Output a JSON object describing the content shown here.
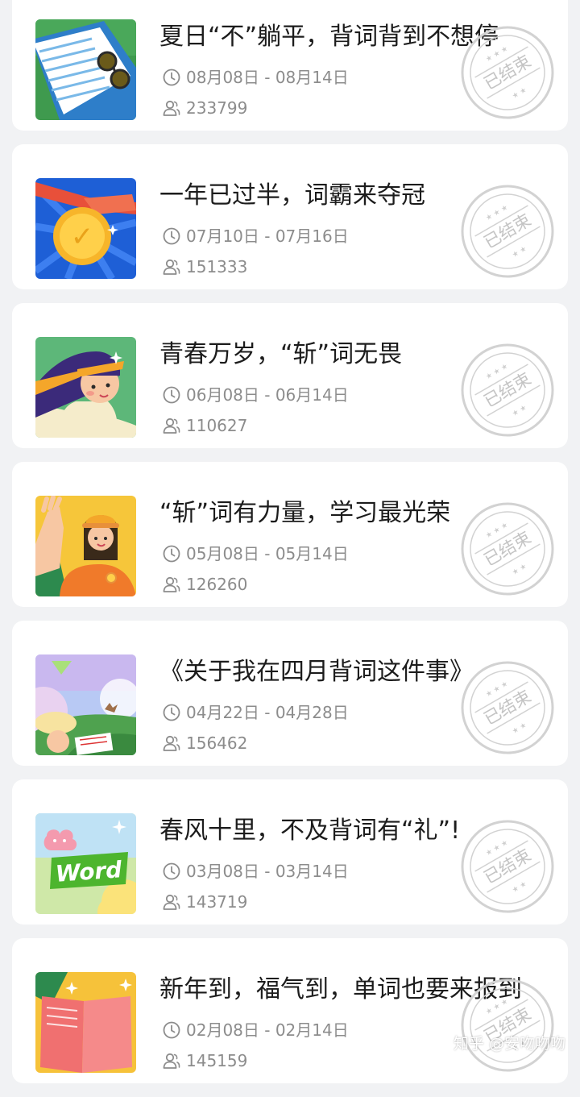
{
  "campaigns": [
    {
      "title": "夏日“不”躺平，背词背到不想停",
      "date_range": "08月08日 - 08月14日",
      "participants": "233799",
      "stamp": "已结束"
    },
    {
      "title": "一年已过半，词霸来夺冠",
      "date_range": "07月10日 - 07月16日",
      "participants": "151333",
      "stamp": "已结束"
    },
    {
      "title": "青春万岁，“斩”词无畏",
      "date_range": "06月08日 - 06月14日",
      "participants": "110627",
      "stamp": "已结束"
    },
    {
      "title": "“斩”词有力量，学习最光荣",
      "date_range": "05月08日 - 05月14日",
      "participants": "126260",
      "stamp": "已结束"
    },
    {
      "title": "《关于我在四月背词这件事》",
      "date_range": "04月22日 - 04月28日",
      "participants": "156462",
      "stamp": "已结束"
    },
    {
      "title": "春风十里，不及背词有“礼”!",
      "date_range": "03月08日 - 03月14日",
      "participants": "143719",
      "stamp": "已结束"
    },
    {
      "title": "新年到，福气到，单词也要来报到",
      "date_range": "02月08日 - 02月14日",
      "participants": "145159",
      "stamp": "已结束"
    }
  ],
  "thumb_texts": {
    "word_badge": "Word"
  },
  "icons": {
    "date": "clock-icon",
    "participants": "users-icon"
  },
  "watermark": "知乎 @安吻吻吻",
  "colors": {
    "background": "#f1f2f4",
    "card": "#ffffff",
    "title": "#1c1c1c",
    "meta": "#8c8c8c",
    "stamp": "#d2d2d2"
  }
}
